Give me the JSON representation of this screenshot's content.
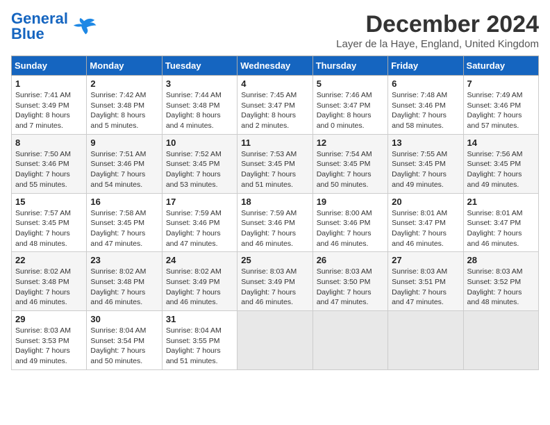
{
  "header": {
    "logo_general": "General",
    "logo_blue": "Blue",
    "month_title": "December 2024",
    "location": "Layer de la Haye, England, United Kingdom"
  },
  "weekdays": [
    "Sunday",
    "Monday",
    "Tuesday",
    "Wednesday",
    "Thursday",
    "Friday",
    "Saturday"
  ],
  "weeks": [
    [
      {
        "day": "1",
        "info": "Sunrise: 7:41 AM\nSunset: 3:49 PM\nDaylight: 8 hours\nand 7 minutes."
      },
      {
        "day": "2",
        "info": "Sunrise: 7:42 AM\nSunset: 3:48 PM\nDaylight: 8 hours\nand 5 minutes."
      },
      {
        "day": "3",
        "info": "Sunrise: 7:44 AM\nSunset: 3:48 PM\nDaylight: 8 hours\nand 4 minutes."
      },
      {
        "day": "4",
        "info": "Sunrise: 7:45 AM\nSunset: 3:47 PM\nDaylight: 8 hours\nand 2 minutes."
      },
      {
        "day": "5",
        "info": "Sunrise: 7:46 AM\nSunset: 3:47 PM\nDaylight: 8 hours\nand 0 minutes."
      },
      {
        "day": "6",
        "info": "Sunrise: 7:48 AM\nSunset: 3:46 PM\nDaylight: 7 hours\nand 58 minutes."
      },
      {
        "day": "7",
        "info": "Sunrise: 7:49 AM\nSunset: 3:46 PM\nDaylight: 7 hours\nand 57 minutes."
      }
    ],
    [
      {
        "day": "8",
        "info": "Sunrise: 7:50 AM\nSunset: 3:46 PM\nDaylight: 7 hours\nand 55 minutes."
      },
      {
        "day": "9",
        "info": "Sunrise: 7:51 AM\nSunset: 3:46 PM\nDaylight: 7 hours\nand 54 minutes."
      },
      {
        "day": "10",
        "info": "Sunrise: 7:52 AM\nSunset: 3:45 PM\nDaylight: 7 hours\nand 53 minutes."
      },
      {
        "day": "11",
        "info": "Sunrise: 7:53 AM\nSunset: 3:45 PM\nDaylight: 7 hours\nand 51 minutes."
      },
      {
        "day": "12",
        "info": "Sunrise: 7:54 AM\nSunset: 3:45 PM\nDaylight: 7 hours\nand 50 minutes."
      },
      {
        "day": "13",
        "info": "Sunrise: 7:55 AM\nSunset: 3:45 PM\nDaylight: 7 hours\nand 49 minutes."
      },
      {
        "day": "14",
        "info": "Sunrise: 7:56 AM\nSunset: 3:45 PM\nDaylight: 7 hours\nand 49 minutes."
      }
    ],
    [
      {
        "day": "15",
        "info": "Sunrise: 7:57 AM\nSunset: 3:45 PM\nDaylight: 7 hours\nand 48 minutes."
      },
      {
        "day": "16",
        "info": "Sunrise: 7:58 AM\nSunset: 3:45 PM\nDaylight: 7 hours\nand 47 minutes."
      },
      {
        "day": "17",
        "info": "Sunrise: 7:59 AM\nSunset: 3:46 PM\nDaylight: 7 hours\nand 47 minutes."
      },
      {
        "day": "18",
        "info": "Sunrise: 7:59 AM\nSunset: 3:46 PM\nDaylight: 7 hours\nand 46 minutes."
      },
      {
        "day": "19",
        "info": "Sunrise: 8:00 AM\nSunset: 3:46 PM\nDaylight: 7 hours\nand 46 minutes."
      },
      {
        "day": "20",
        "info": "Sunrise: 8:01 AM\nSunset: 3:47 PM\nDaylight: 7 hours\nand 46 minutes."
      },
      {
        "day": "21",
        "info": "Sunrise: 8:01 AM\nSunset: 3:47 PM\nDaylight: 7 hours\nand 46 minutes."
      }
    ],
    [
      {
        "day": "22",
        "info": "Sunrise: 8:02 AM\nSunset: 3:48 PM\nDaylight: 7 hours\nand 46 minutes."
      },
      {
        "day": "23",
        "info": "Sunrise: 8:02 AM\nSunset: 3:48 PM\nDaylight: 7 hours\nand 46 minutes."
      },
      {
        "day": "24",
        "info": "Sunrise: 8:02 AM\nSunset: 3:49 PM\nDaylight: 7 hours\nand 46 minutes."
      },
      {
        "day": "25",
        "info": "Sunrise: 8:03 AM\nSunset: 3:49 PM\nDaylight: 7 hours\nand 46 minutes."
      },
      {
        "day": "26",
        "info": "Sunrise: 8:03 AM\nSunset: 3:50 PM\nDaylight: 7 hours\nand 47 minutes."
      },
      {
        "day": "27",
        "info": "Sunrise: 8:03 AM\nSunset: 3:51 PM\nDaylight: 7 hours\nand 47 minutes."
      },
      {
        "day": "28",
        "info": "Sunrise: 8:03 AM\nSunset: 3:52 PM\nDaylight: 7 hours\nand 48 minutes."
      }
    ],
    [
      {
        "day": "29",
        "info": "Sunrise: 8:03 AM\nSunset: 3:53 PM\nDaylight: 7 hours\nand 49 minutes."
      },
      {
        "day": "30",
        "info": "Sunrise: 8:04 AM\nSunset: 3:54 PM\nDaylight: 7 hours\nand 50 minutes."
      },
      {
        "day": "31",
        "info": "Sunrise: 8:04 AM\nSunset: 3:55 PM\nDaylight: 7 hours\nand 51 minutes."
      },
      {
        "day": "",
        "info": ""
      },
      {
        "day": "",
        "info": ""
      },
      {
        "day": "",
        "info": ""
      },
      {
        "day": "",
        "info": ""
      }
    ]
  ]
}
